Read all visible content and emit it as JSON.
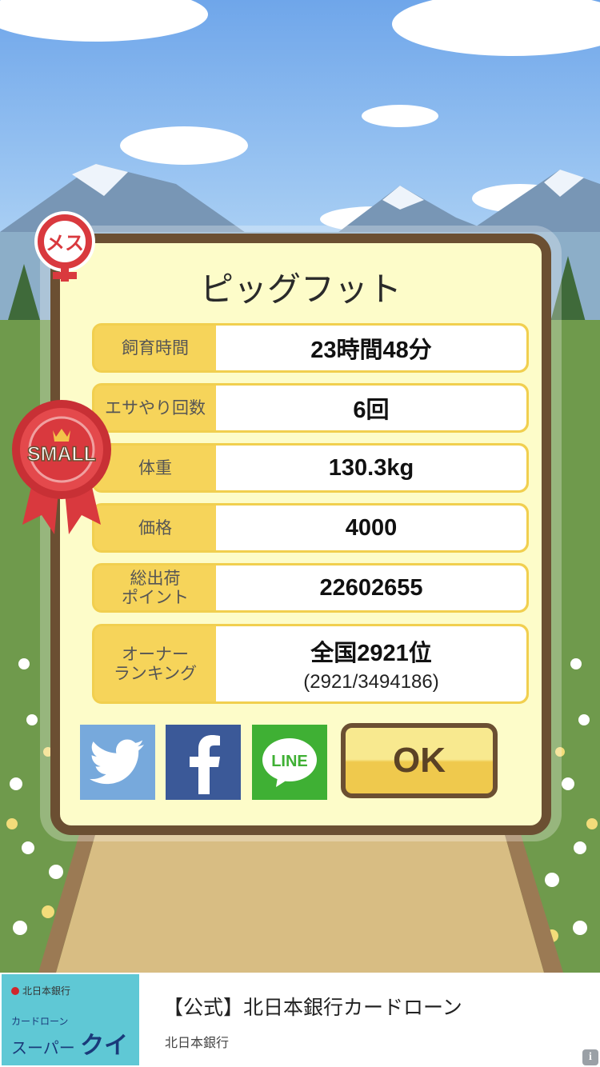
{
  "pig": {
    "name": "ピッグフット",
    "gender_badge": "メス",
    "size_badge": "SMALL"
  },
  "stats": [
    {
      "label": "飼育時間",
      "value": "23時間48分"
    },
    {
      "label": "エサやり回数",
      "value": "6回"
    },
    {
      "label": "体重",
      "value": "130.3kg"
    },
    {
      "label": "価格",
      "value": "4000"
    },
    {
      "label": "総出荷\nポイント",
      "value": "22602655"
    }
  ],
  "ranking": {
    "label": "オーナー\nランキング",
    "value": "全国2921位",
    "detail": "(2921/3494186)"
  },
  "share_buttons": [
    {
      "name": "twitter",
      "icon": "twitter-bird-icon",
      "color": "#77a9dc"
    },
    {
      "name": "facebook",
      "icon": "facebook-f-icon",
      "color": "#3b5998"
    },
    {
      "name": "line",
      "icon": "line-bubble-icon",
      "label": "LINE",
      "color": "#3fb034"
    }
  ],
  "ok_label": "OK",
  "ad": {
    "bank_small": "北日本銀行",
    "card_small": "カードローン",
    "card_prefix": "スーパー",
    "card_name": "クイカ",
    "title": "【公式】北日本銀行カードローン",
    "advertiser": "北日本銀行",
    "info_icon": "i"
  },
  "colors": {
    "panel_bg": "#fdfcc9",
    "panel_border": "#6b4f32",
    "label_bg": "#f6d45a",
    "female_red": "#d9393e"
  }
}
